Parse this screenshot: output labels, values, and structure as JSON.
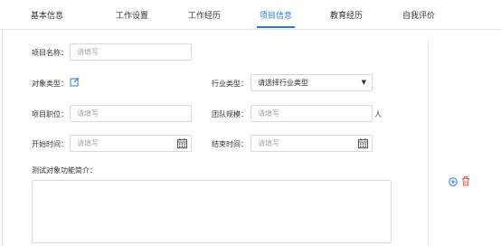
{
  "tabs": [
    {
      "label": "基本信息",
      "active": false
    },
    {
      "label": "工作设置",
      "active": false
    },
    {
      "label": "工作经历",
      "active": false
    },
    {
      "label": "项目信息",
      "active": true
    },
    {
      "label": "教育经历",
      "active": false
    },
    {
      "label": "自我评价",
      "active": false
    }
  ],
  "form": {
    "project_name": {
      "label": "项目名称：",
      "placeholder": "请填写"
    },
    "object_type": {
      "label": "对象类型："
    },
    "industry_type": {
      "label": "行业类型：",
      "value": "请选择行业类型"
    },
    "project_role": {
      "label": "项目职位：",
      "placeholder": "请填写"
    },
    "team_size": {
      "label": "团队规模：",
      "placeholder": "请填写",
      "suffix": "人"
    },
    "start_time": {
      "label": "开始时间：",
      "placeholder": "请填写"
    },
    "end_time": {
      "label": "结束时间：",
      "placeholder": "请填写"
    },
    "intro": {
      "label": "测试对象功能简介："
    }
  },
  "colors": {
    "accent": "#2b79d6",
    "delete": "#e05a4a",
    "add": "#2b79d6"
  },
  "icons": {
    "edit": "edit-icon",
    "calendar": "calendar-icon",
    "add": "add-circle-icon",
    "delete": "trash-icon"
  }
}
